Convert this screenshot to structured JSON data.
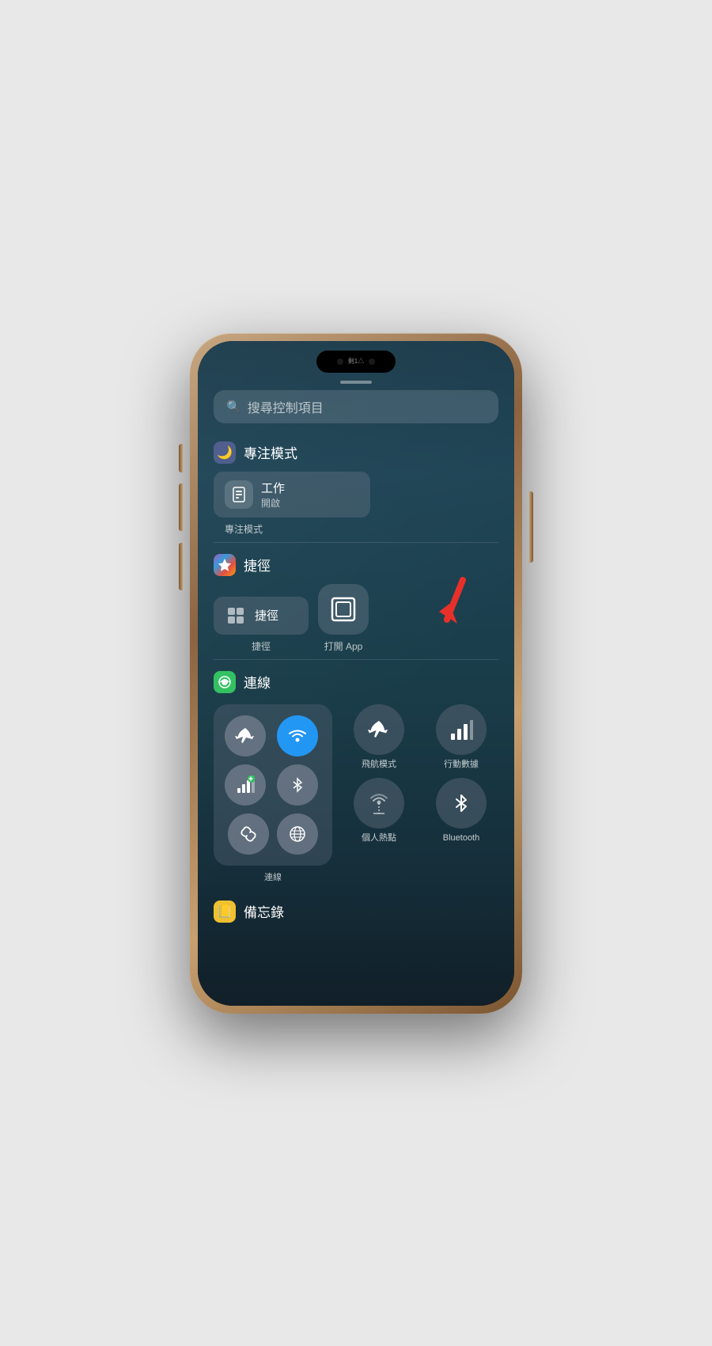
{
  "phone": {
    "dynamic_island_text": "剩1△"
  },
  "search": {
    "placeholder": "搜尋控制項目"
  },
  "focus_section": {
    "icon": "🌙",
    "title": "專注模式",
    "item_name": "工作",
    "item_status": "開啟",
    "item_label": "專注模式"
  },
  "shortcuts_section": {
    "icon_gradient": true,
    "title": "捷徑",
    "shortcut_label": "捷徑",
    "open_app_label": "打開 App"
  },
  "connectivity_section": {
    "title": "連線",
    "conn_label": "連線",
    "airplane_label": "飛航模式",
    "cellular_label": "行動數據",
    "hotspot_label": "個人熱點",
    "bluetooth_label": "Bluetooth"
  },
  "notes_section": {
    "icon": "📒",
    "title": "備忘錄"
  }
}
